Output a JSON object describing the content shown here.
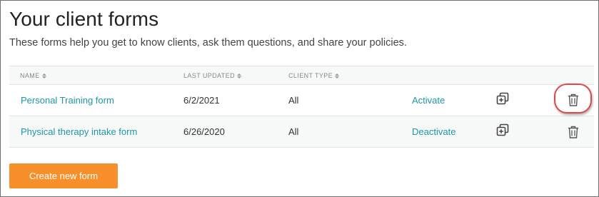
{
  "page": {
    "title": "Your client forms",
    "subtitle": "These forms help you get to know clients, ask them questions, and share your policies."
  },
  "table": {
    "headers": {
      "name": "NAME",
      "last_updated": "LAST UPDATED",
      "client_type": "CLIENT TYPE"
    },
    "rows": [
      {
        "name": "Personal Training form",
        "last_updated": "6/2/2021",
        "client_type": "All",
        "action": "Activate",
        "copy_icon": "duplicate-icon",
        "delete_icon": "trash-icon",
        "delete_highlighted": true
      },
      {
        "name": "Physical therapy intake form",
        "last_updated": "6/26/2020",
        "client_type": "All",
        "action": "Deactivate",
        "copy_icon": "duplicate-icon",
        "delete_icon": "trash-icon",
        "delete_highlighted": false
      }
    ]
  },
  "create_button": {
    "label": "Create new form",
    "color": "#f78f2b"
  },
  "colors": {
    "link": "#1d96a7",
    "highlight": "#e04848"
  }
}
